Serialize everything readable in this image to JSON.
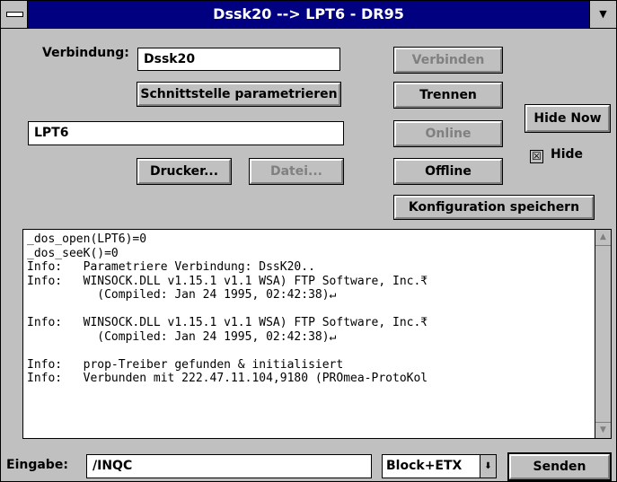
{
  "window": {
    "title": "Dssk20 --> LPT6 - DR95",
    "system_menu_icon": "system-menu-bar",
    "minimize_icon": "down-triangle"
  },
  "connection": {
    "label_prefix": "Verbindung:",
    "value": "Dssk20"
  },
  "buttons": {
    "schnittstelle": "Schnittstelle parametrieren",
    "verbinden": "Verbinden",
    "trennen": "Trennen",
    "online": "Online",
    "offline": "Offline",
    "hide_now": "Hide Now",
    "drucker": "Drucker...",
    "datei": "Datei...",
    "konfiguration": "Konfiguration speichern",
    "senden": "Senden"
  },
  "port": {
    "value": "LPT6"
  },
  "hide": {
    "label": "Hide",
    "checked": true,
    "check_glyph": "☒"
  },
  "log": {
    "lines": [
      "_dos_open(LPT6)=0",
      "_dos_seeK()=0",
      "Info:   Parametriere Verbindung: DssK20..",
      "Info:   WINSOCK.DLL v1.15.1 v1.1 WSA) FTP Software, Inc.₹",
      "          (Compiled: Jan 24 1995, 02:42:38)↵",
      "",
      "Info:   WINSOCK.DLL v1.15.1 v1.1 WSA) FTP Software, Inc.₹",
      "          (Compiled: Jan 24 1995, 02:42:38)↵",
      "",
      "Info:   prop-Treiber gefunden & initialisiert",
      "Info:   Verbunden mit 222.47.11.104,9180 (PROmea-ProtoKol"
    ]
  },
  "input": {
    "label": "Eingabe:",
    "value": "/INQC"
  },
  "mode": {
    "value": "Block+ETX",
    "arrow_glyph": "⬇"
  },
  "colors": {
    "title_bar": "#000080",
    "face": "#c0c0c0",
    "disabled_text": "#808080"
  }
}
